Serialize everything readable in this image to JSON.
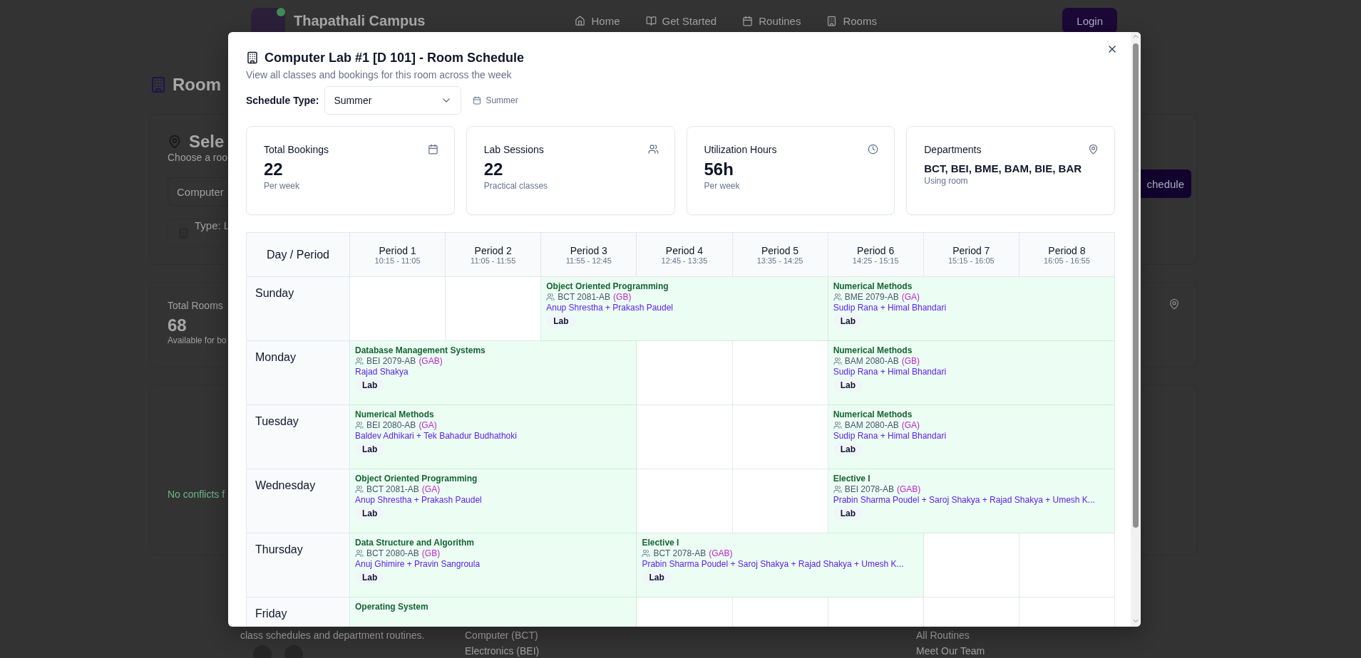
{
  "background": {
    "brand": "Thapathali Campus",
    "nav": [
      {
        "label": "Home"
      },
      {
        "label": "Get Started"
      },
      {
        "label": "Routines"
      },
      {
        "label": "Rooms"
      }
    ],
    "login": "Login",
    "page_title": "Room",
    "select_card": {
      "title": "Sele",
      "subtitle": "Choose a roo",
      "room_field": "Computer",
      "type_label": "Type: L",
      "schedule_button": "chedule"
    },
    "stats_card": {
      "title": "Total Rooms",
      "value": "68",
      "caption": "Available for bo"
    },
    "conflicts_text": "No conflicts f",
    "footer": {
      "tagline": "class schedules and department routines.",
      "departments": [
        "Computer (BCT)",
        "Electronics (BEI)"
      ],
      "links": [
        "All Routines",
        "Meet Our Team"
      ]
    }
  },
  "modal": {
    "title": "Computer Lab #1 [D 101] - Room Schedule",
    "subtitle": "View all classes and bookings for this room across the week",
    "schedule_type": {
      "label": "Schedule Type:",
      "value": "Summer",
      "badge": "Summer"
    },
    "stats": [
      {
        "label": "Total Bookings",
        "value": "22",
        "caption": "Per week",
        "kind": "count"
      },
      {
        "label": "Lab Sessions",
        "value": "22",
        "caption": "Practical classes",
        "kind": "count"
      },
      {
        "label": "Utilization Hours",
        "value": "56h",
        "caption": "Per week",
        "kind": "count"
      },
      {
        "label": "Departments",
        "value": "BCT, BEI, BME, BAM, BIE, BAR",
        "caption": "Using room",
        "kind": "list"
      }
    ],
    "table": {
      "corner": "Day / Period",
      "periods": [
        {
          "name": "Period 1",
          "time": "10:15 - 11:05"
        },
        {
          "name": "Period 2",
          "time": "11:05 - 11:55"
        },
        {
          "name": "Period 3",
          "time": "11:55 - 12:45"
        },
        {
          "name": "Period 4",
          "time": "12:45 - 13:35"
        },
        {
          "name": "Period 5",
          "time": "13:35 - 14:25"
        },
        {
          "name": "Period 6",
          "time": "14:25 - 15:15"
        },
        {
          "name": "Period 7",
          "time": "15:15 - 16:05"
        },
        {
          "name": "Period 8",
          "time": "16:05 - 16:55"
        }
      ],
      "rows": [
        {
          "day": "Sunday",
          "cells": [
            {
              "kind": "empty"
            },
            {
              "kind": "empty"
            },
            {
              "kind": "class",
              "subject": "Object Oriented Programming",
              "group": "BCT 2081-AB",
              "section": "(GB)",
              "teachers": "Anup Shrestha + Prakash Paudel",
              "tag": "Lab"
            },
            {
              "kind": "class",
              "subject": "Numerical Methods",
              "group": "BME 2079-AB",
              "section": "(GA)",
              "teachers": "Sudip Rana + Himal Bhandari",
              "tag": "Lab"
            }
          ]
        },
        {
          "day": "Monday",
          "cells": [
            {
              "kind": "class",
              "subject": "Database Management Systems",
              "group": "BEI 2079-AB",
              "section": "(GAB)",
              "teachers": "Rajad Shakya",
              "tag": "Lab"
            },
            {
              "kind": "empty"
            },
            {
              "kind": "empty"
            },
            {
              "kind": "class",
              "subject": "Numerical Methods",
              "group": "BAM 2080-AB",
              "section": "(GB)",
              "teachers": "Sudip Rana + Himal Bhandari",
              "tag": "Lab"
            }
          ]
        },
        {
          "day": "Tuesday",
          "cells": [
            {
              "kind": "class",
              "subject": "Numerical Methods",
              "group": "BEI 2080-AB",
              "section": "(GA)",
              "teachers": "Baldev Adhikari + Tek Bahadur Budhathoki",
              "tag": "Lab"
            },
            {
              "kind": "empty"
            },
            {
              "kind": "empty"
            },
            {
              "kind": "class",
              "subject": "Numerical Methods",
              "group": "BAM 2080-AB",
              "section": "(GA)",
              "teachers": "Sudip Rana + Himal Bhandari",
              "tag": "Lab"
            }
          ]
        },
        {
          "day": "Wednesday",
          "cells": [
            {
              "kind": "class",
              "subject": "Object Oriented Programming",
              "group": "BCT 2081-AB",
              "section": "(GA)",
              "teachers": "Anup Shrestha + Prakash Paudel",
              "tag": "Lab"
            },
            {
              "kind": "empty"
            },
            {
              "kind": "empty"
            },
            {
              "kind": "class",
              "subject": "Elective I",
              "group": "BEI 2078-AB",
              "section": "(GAB)",
              "teachers": "Prabin Sharma Poudel + Saroj Shakya + Rajad Shakya + Umesh K...",
              "tag": "Lab"
            }
          ]
        },
        {
          "day": "Thursday",
          "cells": [
            {
              "kind": "class",
              "subject": "Data Structure and Algorithm",
              "group": "BCT 2080-AB",
              "section": "(GB)",
              "teachers": "Anuj Ghimire + Pravin Sangroula",
              "tag": "Lab"
            },
            {
              "kind": "class",
              "subject": "Elective I",
              "group": "BCT 2078-AB",
              "section": "(GAB)",
              "teachers": "Prabin Sharma Poudel + Saroj Shakya + Rajad Shakya + Umesh K...",
              "tag": "Lab"
            },
            {
              "kind": "empty"
            },
            {
              "kind": "empty"
            }
          ]
        },
        {
          "day": "Friday",
          "cells": [
            {
              "kind": "class",
              "subject": "Operating System"
            },
            {
              "kind": "empty"
            },
            {
              "kind": "empty"
            },
            {
              "kind": "empty"
            },
            {
              "kind": "empty"
            },
            {
              "kind": "empty"
            }
          ]
        }
      ]
    }
  }
}
